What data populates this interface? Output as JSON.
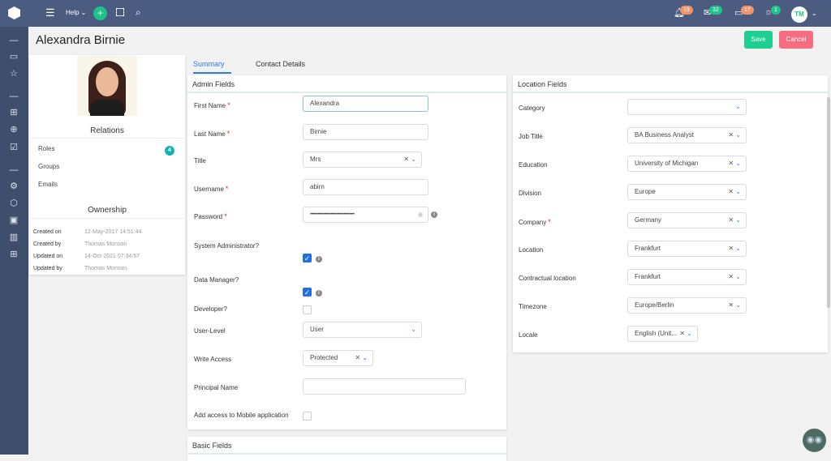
{
  "topbar": {
    "help": "Help",
    "badges": {
      "notifications": "19",
      "messages": "32",
      "calendar": "17",
      "alerts": "1"
    },
    "avatar": "TM"
  },
  "page": {
    "title": "Alexandra Birnie",
    "save": "Save",
    "cancel": "Cancel"
  },
  "profile": {
    "relations_title": "Relations",
    "relations": [
      {
        "label": "Roles",
        "count": "4"
      },
      {
        "label": "Groups"
      },
      {
        "label": "Emails"
      }
    ],
    "ownership_title": "Ownership",
    "ownership": [
      {
        "k": "Created on",
        "v": "12-May-2017 14:51:44"
      },
      {
        "k": "Created by",
        "v": "Thomas Monson"
      },
      {
        "k": "Updated on",
        "v": "14-Oct-2021 07:34:57"
      },
      {
        "k": "Updated by",
        "v": "Thomas Monson"
      }
    ]
  },
  "tabs": [
    {
      "label": "Summary",
      "active": true
    },
    {
      "label": "Contact Details"
    }
  ],
  "admin": {
    "title": "Admin Fields",
    "fields": [
      {
        "label": "First Name",
        "req": true,
        "type": "text",
        "value": "Alexandra",
        "w": 155
      },
      {
        "label": "Last Name",
        "req": true,
        "type": "text",
        "value": "Birnie",
        "w": 155
      },
      {
        "label": "Title",
        "type": "select",
        "value": "Mrs",
        "clear": true,
        "w": 147
      },
      {
        "label": "Username",
        "req": true,
        "type": "text",
        "value": "abirn",
        "w": 155
      },
      {
        "label": "Password",
        "req": true,
        "type": "password",
        "value": "••••••••••••••••••••••••••••••••••",
        "w": 155,
        "info": true
      },
      {
        "label": "System Administrator?",
        "type": "checkbox",
        "checked": true,
        "info": true
      },
      {
        "label": "Data Manager?",
        "type": "checkbox",
        "checked": true,
        "info": true
      },
      {
        "label": "Developer?",
        "type": "checkbox",
        "checked": false
      },
      {
        "label": "User-Level",
        "type": "select",
        "value": "User",
        "w": 147
      },
      {
        "label": "Write Access",
        "type": "select",
        "value": "Protected",
        "clear": true,
        "w": 87
      },
      {
        "label": "Principal Name",
        "type": "text",
        "value": "",
        "w": 201
      },
      {
        "label": "Add access to Mobile application",
        "type": "checkbox",
        "checked": false
      }
    ]
  },
  "basic": {
    "title": "Basic Fields"
  },
  "location": {
    "title": "Location Fields",
    "fields": [
      {
        "label": "Category",
        "value": "",
        "clear": false,
        "w": 147
      },
      {
        "label": "Job Title",
        "value": "BA Business Analyst",
        "clear": true,
        "w": 147
      },
      {
        "label": "Education",
        "value": "University of Michigan",
        "clear": true,
        "w": 147
      },
      {
        "label": "Division",
        "value": "Europe",
        "clear": true,
        "w": 147
      },
      {
        "label": "Company",
        "req": true,
        "value": "Germany",
        "clear": true,
        "w": 147
      },
      {
        "label": "Location",
        "value": "Frankfurt",
        "clear": true,
        "w": 147
      },
      {
        "label": "Contractual location",
        "value": "Frankfurt",
        "clear": true,
        "w": 147
      },
      {
        "label": "Timezone",
        "value": "Europe/Berlin",
        "clear": true,
        "w": 147
      },
      {
        "label": "Locale",
        "value": "English (Unit...",
        "clear": true,
        "w": 87
      }
    ]
  }
}
